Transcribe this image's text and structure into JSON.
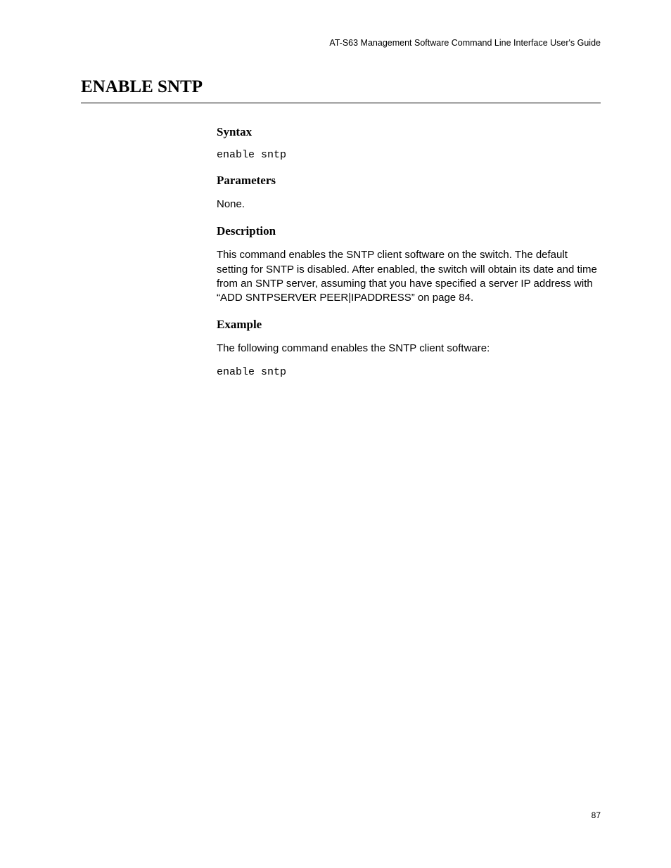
{
  "header": {
    "text": "AT-S63 Management Software Command Line Interface User's Guide"
  },
  "title": "ENABLE SNTP",
  "sections": {
    "syntax": {
      "heading": "Syntax",
      "command": "enable sntp"
    },
    "parameters": {
      "heading": "Parameters",
      "text": "None."
    },
    "description": {
      "heading": "Description",
      "text": "This command enables the SNTP client software on the switch. The default setting for SNTP is disabled. After enabled, the switch will obtain its date and time from an SNTP server, assuming that you have specified a server IP address with “ADD SNTPSERVER PEER|IPADDRESS” on page 84."
    },
    "example": {
      "heading": "Example",
      "text": "The following command enables the SNTP client software:",
      "command": "enable sntp"
    }
  },
  "page_number": "87"
}
